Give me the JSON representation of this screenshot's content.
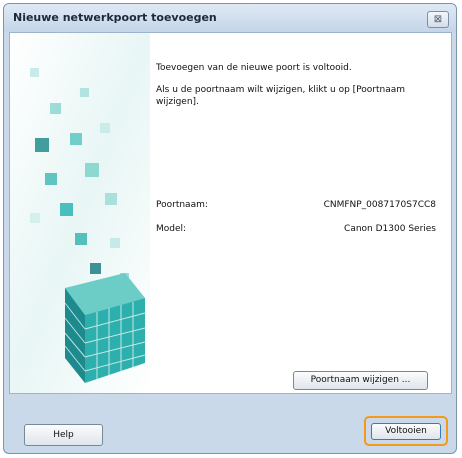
{
  "window": {
    "title": "Nieuwe netwerkpoort toevoegen",
    "close_label": "⊠"
  },
  "content": {
    "message_1": "Toevoegen van de nieuwe poort is voltooid.",
    "message_2": "Als u de poortnaam wilt wijzigen, klikt u op [Poortnaam wijzigen].",
    "port_name_label": "Poortnaam:",
    "port_name_value": "CNMFNP_0087170S7CC8",
    "model_label": "Model:",
    "model_value": "Canon D1300 Series",
    "rename_button": "Poortnaam wijzigen ..."
  },
  "footer": {
    "help_button": "Help",
    "finish_button": "Voltooien"
  },
  "colors": {
    "accent": "#f39a1b",
    "cube_teal": "#2fb5b3"
  },
  "icons": {
    "close": "close-icon",
    "artwork": "cube-artwork"
  }
}
